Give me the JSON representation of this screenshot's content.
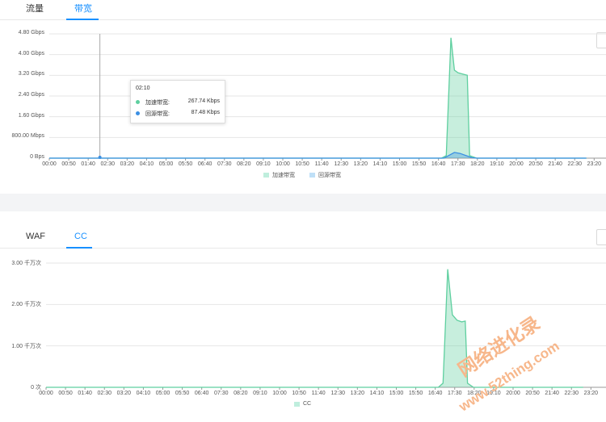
{
  "panel1": {
    "tabs": [
      {
        "label": "流量",
        "active": false
      },
      {
        "label": "带宽",
        "active": true
      }
    ],
    "tooltip": {
      "time": "02:10",
      "rows": [
        {
          "name": "加速带宽:",
          "value": "267.74 Kbps",
          "color": "#5ecf9f"
        },
        {
          "name": "回源带宽:",
          "value": "87.48 Kbps",
          "color": "#3b8fe3"
        }
      ]
    }
  },
  "panel2": {
    "tabs": [
      {
        "label": "WAF",
        "active": false
      },
      {
        "label": "CC",
        "active": true
      }
    ]
  },
  "watermark": {
    "line1": "网络进化录",
    "line2": "www.52thing.com"
  },
  "chart_data": [
    {
      "type": "area",
      "ytick_labels": [
        "0 Bps",
        "800.00 Mbps",
        "1.60 Gbps",
        "2.40 Gbps",
        "3.20 Gbps",
        "4.00 Gbps",
        "4.80 Gbps"
      ],
      "ylim": [
        0,
        4.8
      ],
      "y_unit": "Gbps",
      "x_ticks": [
        "00:00",
        "00:50",
        "01:40",
        "02:30",
        "03:20",
        "04:10",
        "05:00",
        "05:50",
        "06:40",
        "07:30",
        "08:20",
        "09:10",
        "10:00",
        "10:50",
        "11:40",
        "12:30",
        "13:20",
        "14:10",
        "15:00",
        "15:50",
        "16:40",
        "17:30",
        "18:20",
        "19:10",
        "20:00",
        "20:50",
        "21:40",
        "22:30",
        "23:20"
      ],
      "series": [
        {
          "name": "加速带宽",
          "color": "#5ecf9f",
          "points": [
            [
              0,
              0
            ],
            [
              16.8,
              0
            ],
            [
              17.0,
              0.1
            ],
            [
              17.2,
              4.65
            ],
            [
              17.35,
              3.4
            ],
            [
              17.5,
              3.3
            ],
            [
              17.7,
              3.25
            ],
            [
              17.9,
              3.2
            ],
            [
              18.0,
              0.1
            ],
            [
              18.3,
              0
            ],
            [
              23.0,
              0
            ]
          ]
        },
        {
          "name": "回源带宽",
          "color": "#3b8fe3",
          "points": [
            [
              0,
              0
            ],
            [
              16.9,
              0
            ],
            [
              17.1,
              0.1
            ],
            [
              17.35,
              0.22
            ],
            [
              17.6,
              0.18
            ],
            [
              17.9,
              0.08
            ],
            [
              18.1,
              0.02
            ],
            [
              18.3,
              0
            ],
            [
              23.0,
              0
            ]
          ]
        }
      ],
      "grid": true,
      "legend": "bottom"
    },
    {
      "type": "area",
      "ytick_labels": [
        "0 次",
        "1.00 千万次",
        "2.00 千万次",
        "3.00 千万次"
      ],
      "ylim": [
        0,
        3.0
      ],
      "y_unit": "千万次",
      "x_ticks": [
        "00:00",
        "00:50",
        "01:40",
        "02:30",
        "03:20",
        "04:10",
        "05:00",
        "05:50",
        "06:40",
        "07:30",
        "08:20",
        "09:10",
        "10:00",
        "10:50",
        "11:40",
        "12:30",
        "13:20",
        "14:10",
        "15:00",
        "15:50",
        "16:40",
        "17:30",
        "18:20",
        "19:10",
        "20:00",
        "20:50",
        "21:40",
        "22:30",
        "23:20"
      ],
      "series": [
        {
          "name": "CC",
          "color": "#5ecf9f",
          "points": [
            [
              0,
              0
            ],
            [
              16.8,
              0
            ],
            [
              17.0,
              0.1
            ],
            [
              17.2,
              2.85
            ],
            [
              17.4,
              1.75
            ],
            [
              17.6,
              1.62
            ],
            [
              17.8,
              1.58
            ],
            [
              17.95,
              1.6
            ],
            [
              18.05,
              0.1
            ],
            [
              18.3,
              0
            ],
            [
              23.0,
              0
            ]
          ]
        }
      ],
      "grid": true,
      "legend": "bottom"
    }
  ]
}
